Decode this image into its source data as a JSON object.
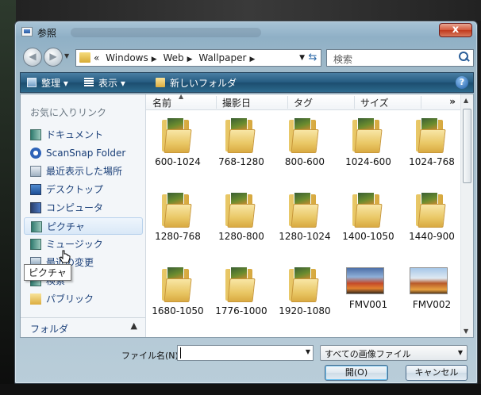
{
  "window": {
    "title": "参照",
    "close_label": "x"
  },
  "address": {
    "prefix": "«",
    "segments": [
      "Windows",
      "Web",
      "Wallpaper"
    ],
    "search_placeholder": "検索"
  },
  "toolbar": {
    "organize": "整理",
    "views": "表示",
    "new_folder": "新しいフォルダ",
    "help": "?"
  },
  "nav": {
    "heading": "お気に入りリンク",
    "items": [
      "ドキュメント",
      "ScanSnap Folder",
      "最近表示した場所",
      "デスクトップ",
      "コンピュータ",
      "ピクチャ",
      "ミュージック",
      "最近の変更",
      "検索",
      "パブリック"
    ],
    "selected": "ピクチャ",
    "folders_label": "フォルダ",
    "tooltip": "ピクチャ"
  },
  "columns": [
    "名前",
    "撮影日",
    "タグ",
    "サイズ"
  ],
  "columns_more": "»",
  "files": [
    {
      "name": "600-1024",
      "type": "folder"
    },
    {
      "name": "768-1280",
      "type": "folder"
    },
    {
      "name": "800-600",
      "type": "folder"
    },
    {
      "name": "1024-600",
      "type": "folder"
    },
    {
      "name": "1024-768",
      "type": "folder"
    },
    {
      "name": "1280-768",
      "type": "folder"
    },
    {
      "name": "1280-800",
      "type": "folder"
    },
    {
      "name": "1280-1024",
      "type": "folder"
    },
    {
      "name": "1400-1050",
      "type": "folder"
    },
    {
      "name": "1440-900",
      "type": "folder"
    },
    {
      "name": "1680-1050",
      "type": "folder"
    },
    {
      "name": "1776-1000",
      "type": "folder"
    },
    {
      "name": "1920-1080",
      "type": "folder"
    },
    {
      "name": "FMV001",
      "type": "image"
    },
    {
      "name": "FMV002",
      "type": "image"
    }
  ],
  "footer": {
    "filename_label": "ファイル名(N):",
    "filename_value": "",
    "filetype": "すべての画像ファイル",
    "open_button": "開(O)",
    "cancel_button": "キャンセル"
  }
}
